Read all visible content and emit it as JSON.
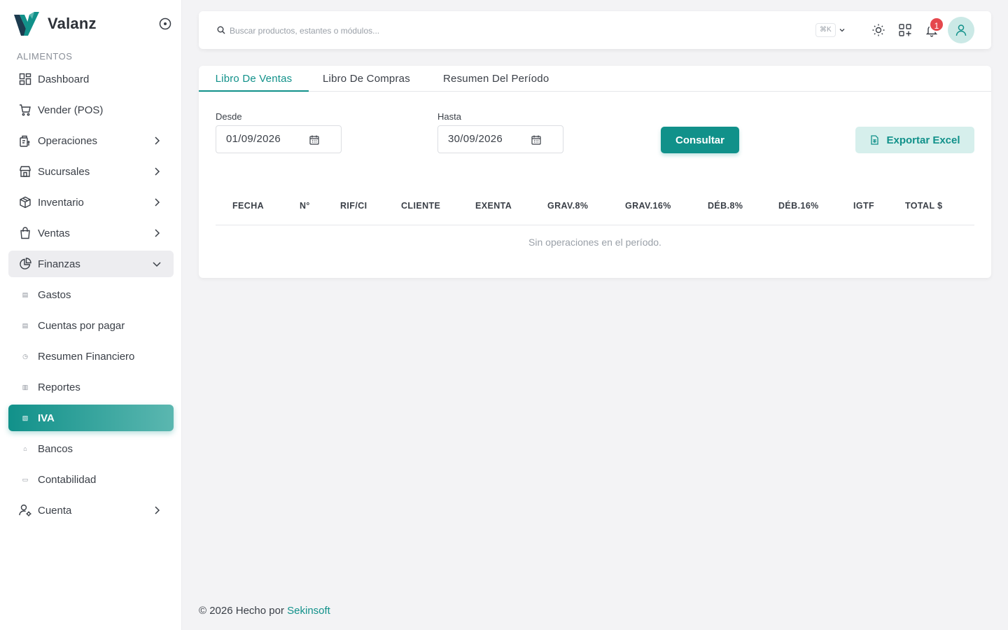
{
  "brand": {
    "name": "Valanz"
  },
  "sidebar": {
    "section_label": "ALIMENTOS",
    "items": [
      {
        "label": "Dashboard",
        "icon": "dashboard-icon"
      },
      {
        "label": "Vender (POS)",
        "icon": "cart-icon"
      },
      {
        "label": "Operaciones",
        "icon": "operations-icon"
      },
      {
        "label": "Sucursales",
        "icon": "store-icon"
      },
      {
        "label": "Inventario",
        "icon": "box-icon"
      },
      {
        "label": "Ventas",
        "icon": "shopping-bag-icon"
      },
      {
        "label": "Finanzas",
        "icon": "pie-chart-icon"
      },
      {
        "label": "Gastos",
        "icon": "doc-icon"
      },
      {
        "label": "Cuentas por pagar",
        "icon": "doc-icon"
      },
      {
        "label": "Resumen Financiero",
        "icon": "pie-icon"
      },
      {
        "label": "Reportes",
        "icon": "bar-chart-icon"
      },
      {
        "label": "IVA",
        "icon": "receipt-icon"
      },
      {
        "label": "Bancos",
        "icon": "bank-icon"
      },
      {
        "label": "Contabilidad",
        "icon": "book-icon"
      },
      {
        "label": "Cuenta",
        "icon": "user-gear-icon"
      }
    ]
  },
  "topbar": {
    "search_placeholder": "Buscar productos, estantes o módulos...",
    "shortcut": "⌘K",
    "notification_count": "1"
  },
  "tabs": [
    {
      "label": "Libro De Ventas",
      "active": true
    },
    {
      "label": "Libro De Compras",
      "active": false
    },
    {
      "label": "Resumen Del Período",
      "active": false
    }
  ],
  "filters": {
    "from_label": "Desde",
    "from_value": "01/09/2026",
    "to_label": "Hasta",
    "to_value": "30/09/2026",
    "query_button": "Consultar",
    "export_button": "Exportar Excel"
  },
  "table": {
    "columns": [
      "FECHA",
      "N°",
      "RIF/CI",
      "CLIENTE",
      "EXENTA",
      "GRAV.8%",
      "GRAV.16%",
      "DÉB.8%",
      "DÉB.16%",
      "IGTF",
      "TOTAL $"
    ],
    "empty_text": "Sin operaciones en el período."
  },
  "footer": {
    "prefix": "© 2026 Hecho por",
    "link": "Sekinsoft"
  },
  "colors": {
    "accent": "#11918a",
    "accent_light": "#d6efec",
    "badge": "#e5484d",
    "background": "#f3f3f5"
  }
}
